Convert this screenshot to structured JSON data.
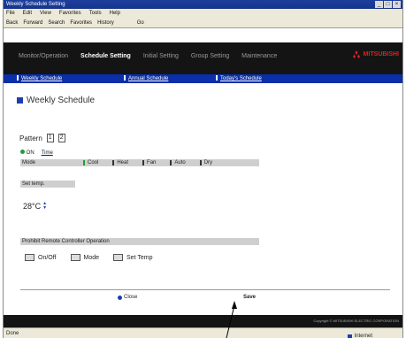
{
  "browser": {
    "window_title": "Weekly Schedule Setting",
    "menu": [
      "File",
      "Edit",
      "View",
      "Favorites",
      "Tools",
      "Help"
    ],
    "address_items": [
      "Back",
      "Forward",
      "Search",
      "Favorites",
      "History",
      "Go"
    ],
    "status_left": "Done",
    "status_zone": "Internet"
  },
  "topnav": {
    "tabs": [
      "Monitor/Operation",
      "Schedule Setting",
      "Initial Setting",
      "Group Setting",
      "Maintenance"
    ],
    "active_tab": "Schedule Setting",
    "logo_text": "MITSUBISHI"
  },
  "subnav": {
    "items": [
      "Weekly Schedule",
      "Annual Schedule",
      "Today's Schedule"
    ]
  },
  "page": {
    "title": "Weekly Schedule"
  },
  "selection": {
    "label": "Pattern",
    "pattern": "1",
    "group": "2"
  },
  "options": {
    "selected": "ON",
    "other": "Time"
  },
  "mode": {
    "label": "Mode",
    "choices": [
      "Cool",
      "Heat",
      "Fan",
      "Auto",
      "Dry"
    ]
  },
  "warmup": {
    "label": "Set temp."
  },
  "temperature": {
    "value": "28°C"
  },
  "prohibition": {
    "label": "Prohibit Remote Controller Operation",
    "checks": [
      "On/Off",
      "Mode",
      "Set Temp"
    ]
  },
  "footer_nav": {
    "prev": "Close",
    "save": "Save"
  },
  "footer": {
    "copyright": "Copyright © MITSUBISHI ELECTRIC CORPORATION"
  }
}
